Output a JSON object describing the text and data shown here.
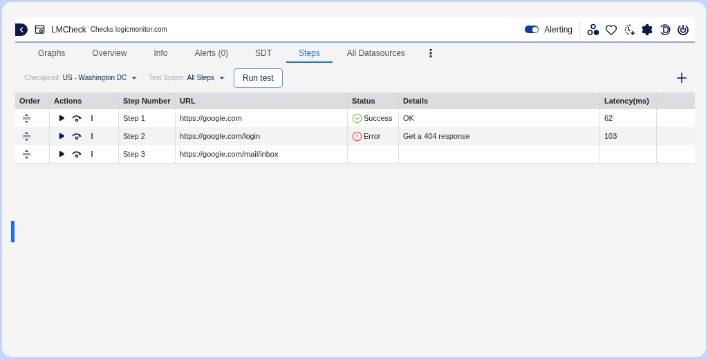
{
  "header": {
    "app_name": "LMCheck",
    "subtitle": "Checks logicmonitor.com",
    "alerting": {
      "label": "Alerting",
      "on": true
    }
  },
  "tabs": [
    {
      "label": "Graphs",
      "selected": false
    },
    {
      "label": "Overview",
      "selected": false
    },
    {
      "label": "Info",
      "selected": false
    },
    {
      "label": "Alerts (0)",
      "selected": false
    },
    {
      "label": "SDT",
      "selected": false
    },
    {
      "label": "Steps",
      "selected": true
    },
    {
      "label": "All Datasources",
      "selected": false
    }
  ],
  "toolbar": {
    "checkpoint": {
      "label": "Checkpoint:",
      "value": "US - Washington DC"
    },
    "test_scope": {
      "label": "Test Scope:",
      "value": "All Steps"
    },
    "run_button": "Run test"
  },
  "table": {
    "columns": [
      "Order",
      "Actions",
      "Step Number",
      "URL",
      "Status",
      "Details",
      "Latency(ms)"
    ],
    "rows": [
      {
        "step": "Step 1",
        "url": "https://google.com",
        "status": {
          "kind": "success",
          "label": "Success"
        },
        "details": "OK",
        "latency": "62"
      },
      {
        "step": "Step 2",
        "url": "https://google.com/login",
        "status": {
          "kind": "error",
          "label": "Error"
        },
        "details": "Get a 404 response",
        "latency": "103"
      },
      {
        "step": "Step 3",
        "url": "https://google.com/mail/inbox"
      }
    ]
  }
}
